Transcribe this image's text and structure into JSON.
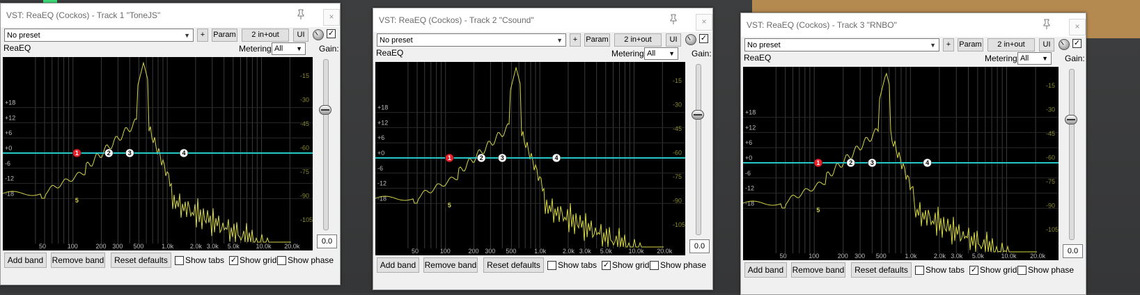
{
  "windows": [
    {
      "title": "VST: ReaEQ (Cockos) - Track 1 \"ToneJS\"",
      "preset": "No preset",
      "add_button": "+",
      "param_button": "Param",
      "io_button": "2 in+out",
      "ui_button": "UI",
      "plugin_name": "ReaEQ",
      "metering_label": "Metering:",
      "metering_value": "All",
      "gain_label": "Gain:",
      "gain_value": "0.0",
      "buttons": {
        "add_band": "Add band",
        "remove_band": "Remove band",
        "reset_defaults": "Reset defaults"
      },
      "checkboxes": [
        {
          "label": "Show tabs",
          "checked": false
        },
        {
          "label": "Show grid",
          "checked": true
        },
        {
          "label": "Show phase",
          "checked": false
        }
      ],
      "bands": [
        "1",
        "2",
        "3",
        "4",
        "5"
      ]
    },
    {
      "title": "VST: ReaEQ (Cockos) - Track 2 \"Csound\"",
      "preset": "No preset",
      "add_button": "+",
      "param_button": "Param",
      "io_button": "2 in+out",
      "ui_button": "UI",
      "plugin_name": "ReaEQ",
      "metering_label": "Metering:",
      "metering_value": "All",
      "gain_label": "Gain:",
      "gain_value": "0.0",
      "buttons": {
        "add_band": "Add band",
        "remove_band": "Remove band",
        "reset_defaults": "Reset defaults"
      },
      "checkboxes": [
        {
          "label": "Show tabs",
          "checked": false
        },
        {
          "label": "Show grid",
          "checked": true
        },
        {
          "label": "Show phase",
          "checked": false
        }
      ],
      "bands": [
        "1",
        "2",
        "3",
        "4",
        "5"
      ]
    },
    {
      "title": "VST: ReaEQ (Cockos) - Track 3 \"RNBO\"",
      "preset": "No preset",
      "add_button": "+",
      "param_button": "Param",
      "io_button": "2 in+out",
      "ui_button": "UI",
      "plugin_name": "ReaEQ",
      "metering_label": "Metering:",
      "metering_value": "All",
      "gain_label": "Gain:",
      "gain_value": "0.0",
      "buttons": {
        "add_band": "Add band",
        "remove_band": "Remove band",
        "reset_defaults": "Reset defaults"
      },
      "checkboxes": [
        {
          "label": "Show tabs",
          "checked": false
        },
        {
          "label": "Show grid",
          "checked": true
        },
        {
          "label": "Show phase",
          "checked": false
        }
      ],
      "bands": [
        "1",
        "2",
        "3",
        "4",
        "5"
      ]
    }
  ],
  "graph_axes": {
    "left_ticks": [
      "+18",
      "+12",
      "+6",
      "+0",
      "-6",
      "-12",
      "-18"
    ],
    "right_ticks": [
      "-15",
      "-30",
      "-45",
      "-60",
      "-75",
      "-90",
      "-105"
    ],
    "x_ticks": [
      "50",
      "100",
      "200",
      "300",
      "500",
      "1.0k",
      "2.0k",
      "3.0k",
      "5.0k",
      "10.0k",
      "20.0k"
    ]
  },
  "colors": {
    "zero_line": "#27c7c7",
    "curve": "#d6d64a",
    "band1": "#e8202a",
    "band_other": "#ffffff"
  }
}
